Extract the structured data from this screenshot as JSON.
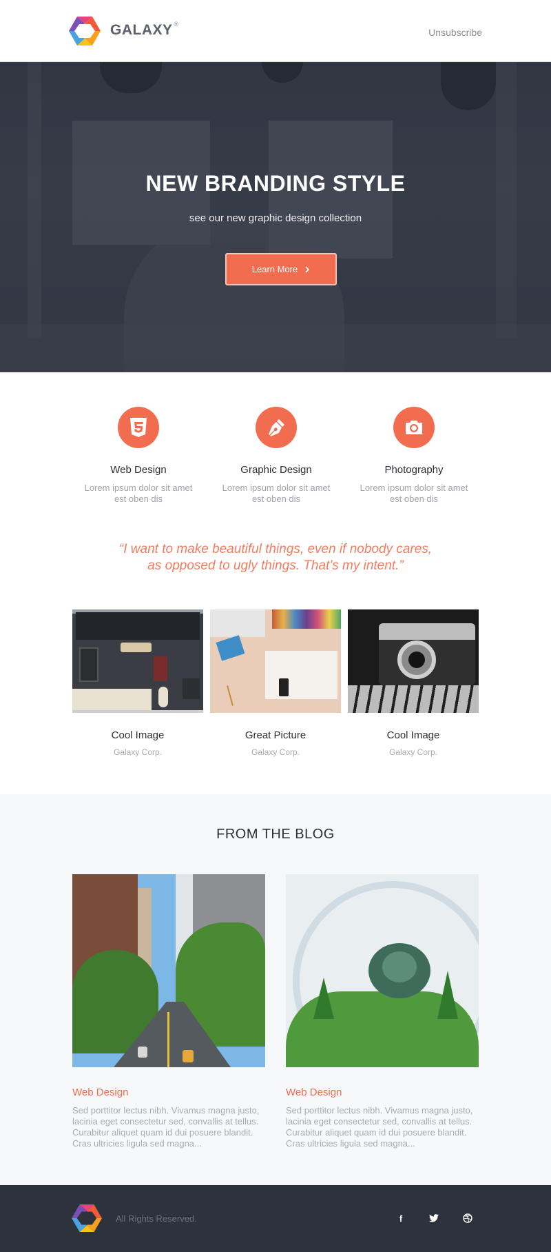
{
  "header": {
    "brand": "GALAXY",
    "brand_mark": "®",
    "unsubscribe": "Unsubscribe"
  },
  "hero": {
    "title": "NEW BRANDING STYLE",
    "subtitle": "see our new graphic design collection",
    "cta_label": "Learn More",
    "cta_icon": "chevron-right-icon"
  },
  "services": [
    {
      "title": "Web Design",
      "text": "Lorem ipsum dolor sit amet est oben dis",
      "icon": "html5-icon"
    },
    {
      "title": "Graphic Design",
      "text": "Lorem ipsum dolor sit amet est oben dis",
      "icon": "pen-nib-icon"
    },
    {
      "title": "Photography",
      "text": "Lorem ipsum dolor sit amet est oben dis",
      "icon": "camera-icon"
    }
  ],
  "quote": {
    "line1": "“I want to make beautiful things, even if nobody cares,",
    "line2": "as opposed to ugly things. That’s my intent.”"
  },
  "gallery": [
    {
      "title": "Cool Image",
      "subtitle": "Galaxy Corp."
    },
    {
      "title": "Great Picture",
      "subtitle": "Galaxy Corp."
    },
    {
      "title": "Cool Image",
      "subtitle": "Galaxy Corp."
    }
  ],
  "blog": {
    "heading": "FROM THE BLOG",
    "posts": [
      {
        "category": "Web Design",
        "text": "Sed porttitor lectus nibh. Vivamus magna justo, lacinia eget consectetur sed, convallis at tellus. Curabitur aliquet quam id dui posuere blandit. Cras ultricies ligula sed magna..."
      },
      {
        "category": "Web Design",
        "text": "Sed porttitor lectus nibh. Vivamus magna justo, lacinia eget consectetur sed, convallis at tellus. Curabitur aliquet quam id dui posuere blandit. Cras ultricies ligula sed magna..."
      }
    ]
  },
  "footer": {
    "rights": "All Rights Reserved.",
    "social": [
      {
        "icon": "facebook-icon",
        "glyph": "f"
      },
      {
        "icon": "twitter-icon",
        "glyph": "✦"
      },
      {
        "icon": "dribbble-icon",
        "glyph": "◎"
      }
    ]
  },
  "colors": {
    "accent": "#f26c4f",
    "quote": "#f07d62",
    "footer_bg": "#2e323c",
    "blog_bg": "#f7f8fa"
  }
}
